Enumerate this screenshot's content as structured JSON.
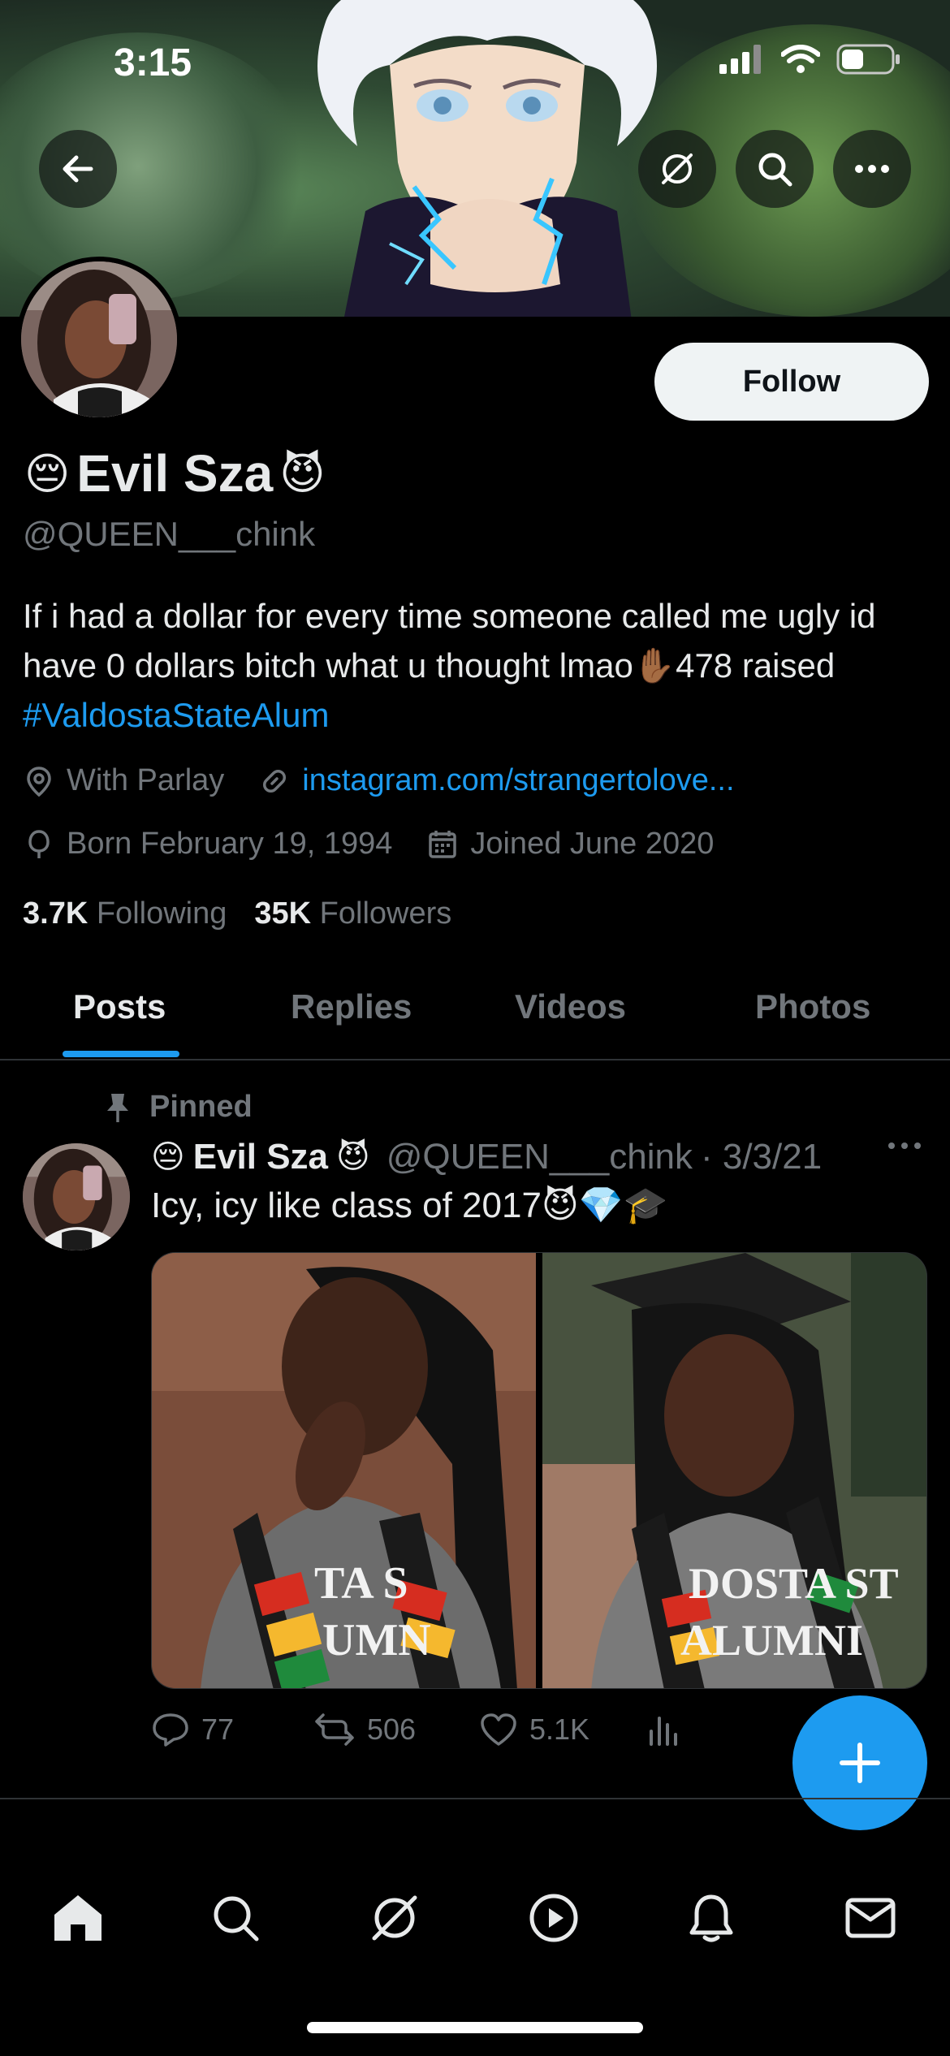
{
  "status_bar": {
    "time": "3:15"
  },
  "profile": {
    "name": "Evil Sza",
    "name_prefix_emoji": "😔",
    "name_suffix_emoji": "😈",
    "handle": "@QUEEN___chink",
    "follow_label": "Follow",
    "bio_text": "If i had a dollar for every time someone called me ugly id have 0 dollars bitch what u thought lmao✋🏾478 raised ",
    "bio_hashtag": "#ValdostaStateAlum",
    "location": "With Parlay",
    "website": "instagram.com/strangertolove...",
    "birthday": "Born February 19, 1994",
    "joined": "Joined June 2020",
    "following_count": "3.7K",
    "following_label": "Following",
    "followers_count": "35K",
    "followers_label": "Followers"
  },
  "tabs": [
    {
      "label": "Posts",
      "active": true
    },
    {
      "label": "Replies",
      "active": false
    },
    {
      "label": "Videos",
      "active": false
    },
    {
      "label": "Photos",
      "active": false
    }
  ],
  "post": {
    "pinned_label": "Pinned",
    "author_name": "Evil Sza",
    "author_prefix_emoji": "😔",
    "author_suffix_emoji": "😈",
    "author_handle": "@QUEEN___chink",
    "date": "· 3/3/21",
    "text": "Icy, icy like class of 2017😈💎🎓",
    "replies": "77",
    "reposts": "506",
    "likes": "5.1K",
    "image_text_left": "TA S\nUMN",
    "image_text_right": "DOSTA ST\nALUMNI"
  },
  "colors": {
    "accent": "#1d9bf0",
    "muted": "#71767b",
    "text": "#e7e9ea",
    "background": "#000000"
  },
  "icons": [
    "back-arrow-icon",
    "grok-icon",
    "search-icon",
    "more-icon",
    "location-icon",
    "link-icon",
    "birthday-icon",
    "calendar-icon",
    "pin-icon",
    "reply-icon",
    "repost-icon",
    "like-icon",
    "views-icon",
    "plus-icon",
    "home-icon",
    "explore-icon",
    "grok-nav-icon",
    "video-icon",
    "bell-icon",
    "mail-icon"
  ]
}
